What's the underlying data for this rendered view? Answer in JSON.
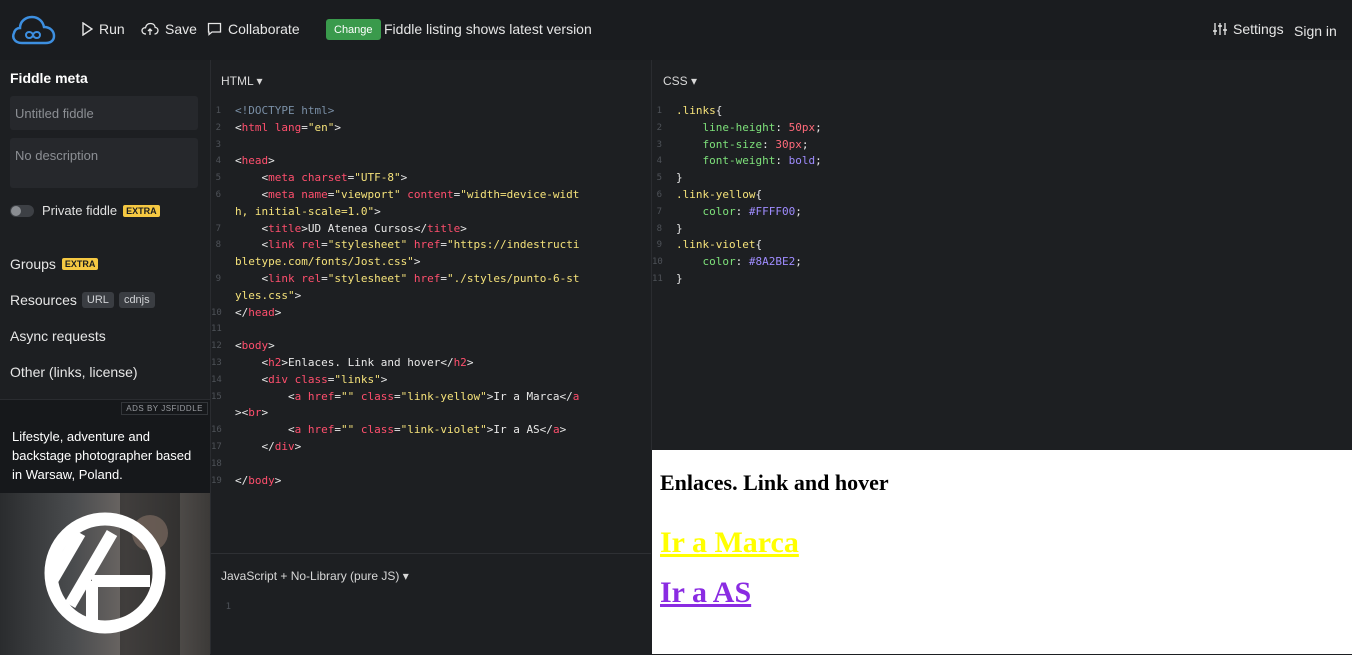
{
  "topbar": {
    "run_label": "Run",
    "save_label": "Save",
    "collaborate_label": "Collaborate",
    "change_badge": "Change",
    "change_message": "Fiddle listing shows latest version",
    "settings_label": "Settings",
    "signin_label": "Sign in"
  },
  "sidebar": {
    "title": "Fiddle meta",
    "name_placeholder": "Untitled fiddle",
    "description_placeholder": "No description",
    "private_label": "Private fiddle",
    "extra_badge": "EXTRA",
    "groups_label": "Groups",
    "groups_badge": "EXTRA",
    "resources_label": "Resources",
    "resources_tags": [
      "URL",
      "cdnjs"
    ],
    "async_label": "Async requests",
    "other_label": "Other (links, license)",
    "ads_label": "ADS BY JSFIDDLE",
    "ad_text": "Lifestyle, adventure and backstage photographer based in Warsaw, Poland."
  },
  "panels": {
    "html_label": "HTML ▾",
    "css_label": "CSS ▾",
    "js_label": "JavaScript + No-Library (pure JS) ▾"
  },
  "html_code": [
    {
      "n": "1",
      "s": [
        [
          "t-doc",
          "<!DOCTYPE html>"
        ]
      ]
    },
    {
      "n": "2",
      "s": [
        [
          "t-txt",
          "<"
        ],
        [
          "t-tag",
          "html"
        ],
        [
          "t-attr",
          " lang"
        ],
        [
          "t-txt",
          "="
        ],
        [
          "t-str",
          "\"en\""
        ],
        [
          "t-txt",
          ">"
        ]
      ]
    },
    {
      "n": "3",
      "s": []
    },
    {
      "n": "4",
      "s": [
        [
          "t-txt",
          "<"
        ],
        [
          "t-tag",
          "head"
        ],
        [
          "t-txt",
          ">"
        ]
      ]
    },
    {
      "n": "5",
      "s": [
        [
          "t-txt",
          "    <"
        ],
        [
          "t-tag",
          "meta"
        ],
        [
          "t-attr",
          " charset"
        ],
        [
          "t-txt",
          "="
        ],
        [
          "t-str",
          "\"UTF-8\""
        ],
        [
          "t-txt",
          ">"
        ]
      ]
    },
    {
      "n": "6",
      "s": [
        [
          "t-txt",
          "    <"
        ],
        [
          "t-tag",
          "meta"
        ],
        [
          "t-attr",
          " name"
        ],
        [
          "t-txt",
          "="
        ],
        [
          "t-str",
          "\"viewport\""
        ],
        [
          "t-attr",
          " content"
        ],
        [
          "t-txt",
          "="
        ],
        [
          "t-str",
          "\"width=device-widt"
        ]
      ]
    },
    {
      "n": "",
      "s": [
        [
          "t-str",
          "h, initial-scale=1.0\""
        ],
        [
          "t-txt",
          ">"
        ]
      ]
    },
    {
      "n": "7",
      "s": [
        [
          "t-txt",
          "    <"
        ],
        [
          "t-tag",
          "title"
        ],
        [
          "t-txt",
          ">UD Atenea Cursos</"
        ],
        [
          "t-tag",
          "title"
        ],
        [
          "t-txt",
          ">"
        ]
      ]
    },
    {
      "n": "8",
      "s": [
        [
          "t-txt",
          "    <"
        ],
        [
          "t-tag",
          "link"
        ],
        [
          "t-attr",
          " rel"
        ],
        [
          "t-txt",
          "="
        ],
        [
          "t-str",
          "\"stylesheet\""
        ],
        [
          "t-attr",
          " href"
        ],
        [
          "t-txt",
          "="
        ],
        [
          "t-str",
          "\"https://indestructi"
        ]
      ]
    },
    {
      "n": "",
      "s": [
        [
          "t-str",
          "bletype.com/fonts/Jost.css\""
        ],
        [
          "t-txt",
          ">"
        ]
      ]
    },
    {
      "n": "9",
      "s": [
        [
          "t-txt",
          "    <"
        ],
        [
          "t-tag",
          "link"
        ],
        [
          "t-attr",
          " rel"
        ],
        [
          "t-txt",
          "="
        ],
        [
          "t-str",
          "\"stylesheet\""
        ],
        [
          "t-attr",
          " href"
        ],
        [
          "t-txt",
          "="
        ],
        [
          "t-str",
          "\"./styles/punto-6-st"
        ]
      ]
    },
    {
      "n": "",
      "s": [
        [
          "t-str",
          "yles.css\""
        ],
        [
          "t-txt",
          ">"
        ]
      ]
    },
    {
      "n": "10",
      "s": [
        [
          "t-txt",
          "</"
        ],
        [
          "t-tag",
          "head"
        ],
        [
          "t-txt",
          ">"
        ]
      ]
    },
    {
      "n": "11",
      "s": []
    },
    {
      "n": "12",
      "s": [
        [
          "t-txt",
          "<"
        ],
        [
          "t-tag",
          "body"
        ],
        [
          "t-txt",
          ">"
        ]
      ]
    },
    {
      "n": "13",
      "s": [
        [
          "t-txt",
          "    <"
        ],
        [
          "t-tag",
          "h2"
        ],
        [
          "t-txt",
          ">Enlaces. Link and hover</"
        ],
        [
          "t-tag",
          "h2"
        ],
        [
          "t-txt",
          ">"
        ]
      ]
    },
    {
      "n": "14",
      "s": [
        [
          "t-txt",
          "    <"
        ],
        [
          "t-tag",
          "div"
        ],
        [
          "t-attr",
          " class"
        ],
        [
          "t-txt",
          "="
        ],
        [
          "t-str",
          "\"links\""
        ],
        [
          "t-txt",
          ">"
        ]
      ]
    },
    {
      "n": "15",
      "s": [
        [
          "t-txt",
          "        <"
        ],
        [
          "t-tag",
          "a"
        ],
        [
          "t-attr",
          " href"
        ],
        [
          "t-txt",
          "="
        ],
        [
          "t-str",
          "\"\""
        ],
        [
          "t-attr",
          " class"
        ],
        [
          "t-txt",
          "="
        ],
        [
          "t-str",
          "\"link-yellow\""
        ],
        [
          "t-txt",
          ">Ir a Marca</"
        ],
        [
          "t-tag",
          "a"
        ]
      ]
    },
    {
      "n": "",
      "s": [
        [
          "t-txt",
          "><"
        ],
        [
          "t-tag",
          "br"
        ],
        [
          "t-txt",
          ">"
        ]
      ]
    },
    {
      "n": "16",
      "s": [
        [
          "t-txt",
          "        <"
        ],
        [
          "t-tag",
          "a"
        ],
        [
          "t-attr",
          " href"
        ],
        [
          "t-txt",
          "="
        ],
        [
          "t-str",
          "\"\""
        ],
        [
          "t-attr",
          " class"
        ],
        [
          "t-txt",
          "="
        ],
        [
          "t-str",
          "\"link-violet\""
        ],
        [
          "t-txt",
          ">Ir a AS</"
        ],
        [
          "t-tag",
          "a"
        ],
        [
          "t-txt",
          ">"
        ]
      ]
    },
    {
      "n": "17",
      "s": [
        [
          "t-txt",
          "    </"
        ],
        [
          "t-tag",
          "div"
        ],
        [
          "t-txt",
          ">"
        ]
      ]
    },
    {
      "n": "18",
      "s": []
    },
    {
      "n": "19",
      "s": [
        [
          "t-txt",
          "</"
        ],
        [
          "t-tag",
          "body"
        ],
        [
          "t-txt",
          ">"
        ]
      ]
    }
  ],
  "css_code": [
    {
      "n": "1",
      "s": [
        [
          "c-sel",
          ".links"
        ],
        [
          "t-txt",
          "{"
        ]
      ]
    },
    {
      "n": "2",
      "s": [
        [
          "t-txt",
          "    "
        ],
        [
          "c-prop",
          "line-height"
        ],
        [
          "t-txt",
          ": "
        ],
        [
          "c-num",
          "50px"
        ],
        [
          "t-txt",
          ";"
        ]
      ]
    },
    {
      "n": "3",
      "s": [
        [
          "t-txt",
          "    "
        ],
        [
          "c-prop",
          "font-size"
        ],
        [
          "t-txt",
          ": "
        ],
        [
          "c-num",
          "30px"
        ],
        [
          "t-txt",
          ";"
        ]
      ]
    },
    {
      "n": "4",
      "s": [
        [
          "t-txt",
          "    "
        ],
        [
          "c-prop",
          "font-weight"
        ],
        [
          "t-txt",
          ": "
        ],
        [
          "c-kw",
          "bold"
        ],
        [
          "t-txt",
          ";"
        ]
      ]
    },
    {
      "n": "5",
      "s": [
        [
          "t-txt",
          "}"
        ]
      ]
    },
    {
      "n": "6",
      "s": [
        [
          "c-sel",
          ".link-yellow"
        ],
        [
          "t-txt",
          "{"
        ]
      ]
    },
    {
      "n": "7",
      "s": [
        [
          "t-txt",
          "    "
        ],
        [
          "c-prop",
          "color"
        ],
        [
          "t-txt",
          ": "
        ],
        [
          "c-col",
          "#FFFF00"
        ],
        [
          "t-txt",
          ";"
        ]
      ]
    },
    {
      "n": "8",
      "s": [
        [
          "t-txt",
          "}"
        ]
      ]
    },
    {
      "n": "9",
      "s": [
        [
          "c-sel",
          ".link-violet"
        ],
        [
          "t-txt",
          "{"
        ]
      ]
    },
    {
      "n": "10",
      "s": [
        [
          "t-txt",
          "    "
        ],
        [
          "c-prop",
          "color"
        ],
        [
          "t-txt",
          ": "
        ],
        [
          "c-col",
          "#8A2BE2"
        ],
        [
          "t-txt",
          ";"
        ]
      ]
    },
    {
      "n": "11",
      "s": [
        [
          "t-txt",
          "}"
        ]
      ]
    }
  ],
  "js_code": [
    {
      "n": "1",
      "s": []
    }
  ],
  "result": {
    "heading": "Enlaces. Link and hover",
    "link1": "Ir a Marca",
    "link2": "Ir a AS"
  },
  "colors": {
    "accent_badge": "#3a9a4c",
    "extra_badge": "#f5c842",
    "link_yellow": "#FFFF00",
    "link_violet": "#8A2BE2"
  }
}
